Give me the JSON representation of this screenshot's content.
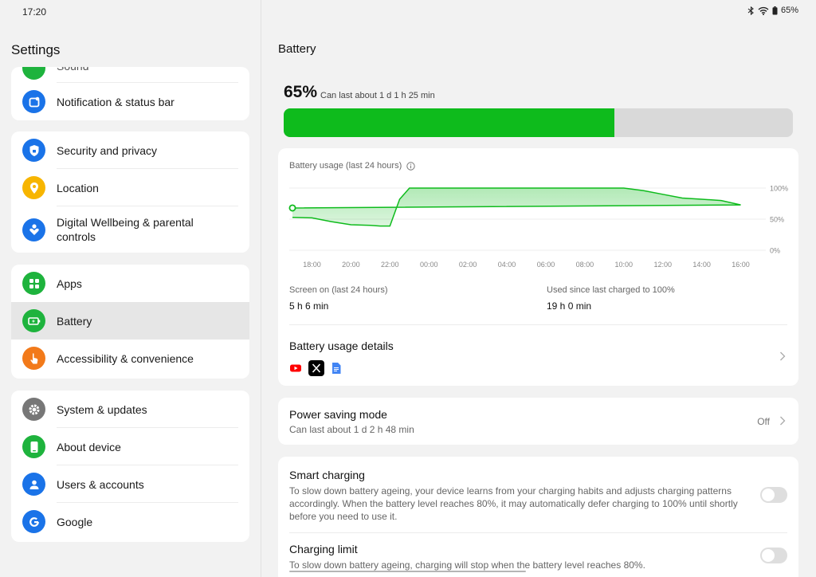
{
  "status_bar": {
    "time": "17:20",
    "battery": "65%"
  },
  "sidebar": {
    "title": "Settings",
    "partial_item": "Sound",
    "items": [
      {
        "label": "Notification & status bar"
      },
      {
        "label": "Security and privacy"
      },
      {
        "label": "Location"
      },
      {
        "label": "Digital Wellbeing & parental controls"
      },
      {
        "label": "Apps"
      },
      {
        "label": "Battery"
      },
      {
        "label": "Accessibility & convenience"
      },
      {
        "label": "System & updates"
      },
      {
        "label": "About device"
      },
      {
        "label": "Users & accounts"
      },
      {
        "label": "Google"
      }
    ]
  },
  "battery": {
    "title": "Battery",
    "percent_text": "65%",
    "level": 0.65,
    "estimate": "Can last about 1 d 1 h 25 min",
    "usage": {
      "title": "Battery usage (last 24 hours)",
      "y_labels": [
        "100%",
        "50%",
        "0%"
      ],
      "x_labels": [
        "18:00",
        "20:00",
        "22:00",
        "00:00",
        "02:00",
        "04:00",
        "06:00",
        "08:00",
        "10:00",
        "12:00",
        "14:00",
        "16:00"
      ],
      "screen_on_label": "Screen on (last 24 hours)",
      "screen_on_value": "5 h 6 min",
      "since_charge_label": "Used since last charged to 100%",
      "since_charge_value": "19 h 0 min"
    },
    "details": {
      "label": "Battery usage details"
    },
    "power_saving": {
      "label": "Power saving mode",
      "sub": "Can last about 1 d 2 h 48 min",
      "value": "Off"
    },
    "smart_charging": {
      "label": "Smart charging",
      "desc": "To slow down battery ageing, your device learns from your charging habits and adjusts charging patterns accordingly. When the battery level reaches 80%, it may automatically defer charging to 100% until shortly before you need to use it."
    },
    "charging_limit": {
      "label": "Charging limit",
      "desc": "To slow down battery ageing, charging will stop when the battery level reaches 80%."
    }
  },
  "colors": {
    "accent_green": "#0ebb1c",
    "icon_blue": "#1a73e8"
  },
  "chart_data": {
    "type": "area",
    "x": [
      "17:00",
      "18:00",
      "19:00",
      "20:00",
      "21:00",
      "21:30",
      "22:00",
      "22:30",
      "23:00",
      "00:00",
      "02:00",
      "04:00",
      "06:00",
      "08:00",
      "10:00",
      "11:00",
      "12:00",
      "13:00",
      "14:00",
      "15:00",
      "16:00",
      "17:00"
    ],
    "values": [
      53,
      52,
      46,
      41,
      40,
      39,
      39,
      82,
      100,
      100,
      100,
      100,
      100,
      100,
      100,
      96,
      90,
      84,
      82,
      80,
      73,
      68
    ],
    "ylim": [
      0,
      100
    ],
    "y_ticks": [
      "0%",
      "50%",
      "100%"
    ]
  }
}
